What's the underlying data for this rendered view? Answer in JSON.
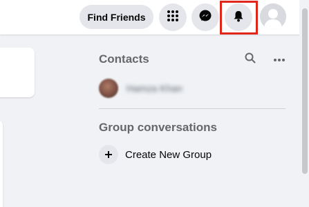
{
  "header": {
    "find_friends_label": "Find Friends",
    "icons": [
      "apps-grid-icon",
      "messenger-icon",
      "bell-icon",
      "profile-avatar"
    ],
    "highlight_color": "#e1251b"
  },
  "contacts": {
    "title": "Contacts",
    "items": [
      {
        "name": "Hamza Khan"
      }
    ]
  },
  "groups": {
    "title": "Group conversations",
    "create_label": "Create New Group"
  }
}
